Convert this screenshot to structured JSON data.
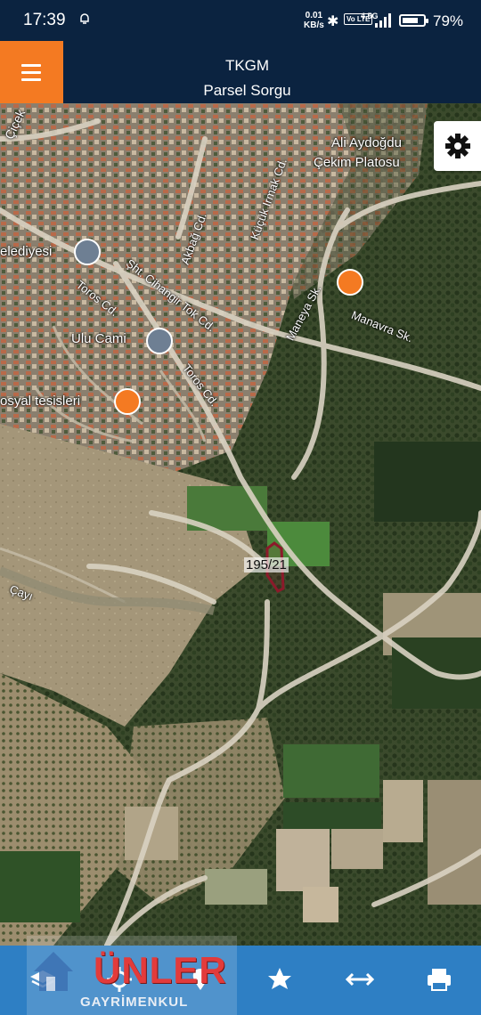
{
  "status_bar": {
    "time": "17:39",
    "net_speed_value": "0.01",
    "net_speed_unit": "KB/s",
    "volte": "Vo LTE",
    "signal_type": "4.5G",
    "battery_percent": "79%",
    "battery_level": 0.79
  },
  "header": {
    "title": "TKGM",
    "subtitle": "Parsel Sorgu",
    "accent_color": "#f47a22",
    "background_color": "#0b2340"
  },
  "map": {
    "labels": {
      "cicek": "Çiçek",
      "ali_aydogdu": "Ali Aydoğdu",
      "cekim_platosu": "Çekim Platosu",
      "kucuk_irmak": "Küçük Irmak Cd.",
      "akbag": "Akbağ Cd.",
      "belediyesi": "elediyesi",
      "cihangir": "Şht. Cihangir Tok Cd.",
      "toros1": "Toros Cd.",
      "ulu_cami": "Ulu Cami",
      "maneya": "Maneya Sk.",
      "manavra": "Manavra Sk.",
      "sosyal": "osyal tesisleri",
      "toros2": "Toros Cd.",
      "cayi": "Çayı"
    },
    "parcel": {
      "label": "195/21",
      "outline_color": "#8b1a2a"
    }
  },
  "toolbar": {
    "background_color": "#2e7fc4",
    "items": [
      "layers-icon",
      "location-target-icon",
      "marker-icon",
      "star-icon",
      "measure-icon",
      "print-icon"
    ]
  },
  "watermark": {
    "brand": "ÜNLER",
    "sub": "GAYRİMENKUL"
  }
}
